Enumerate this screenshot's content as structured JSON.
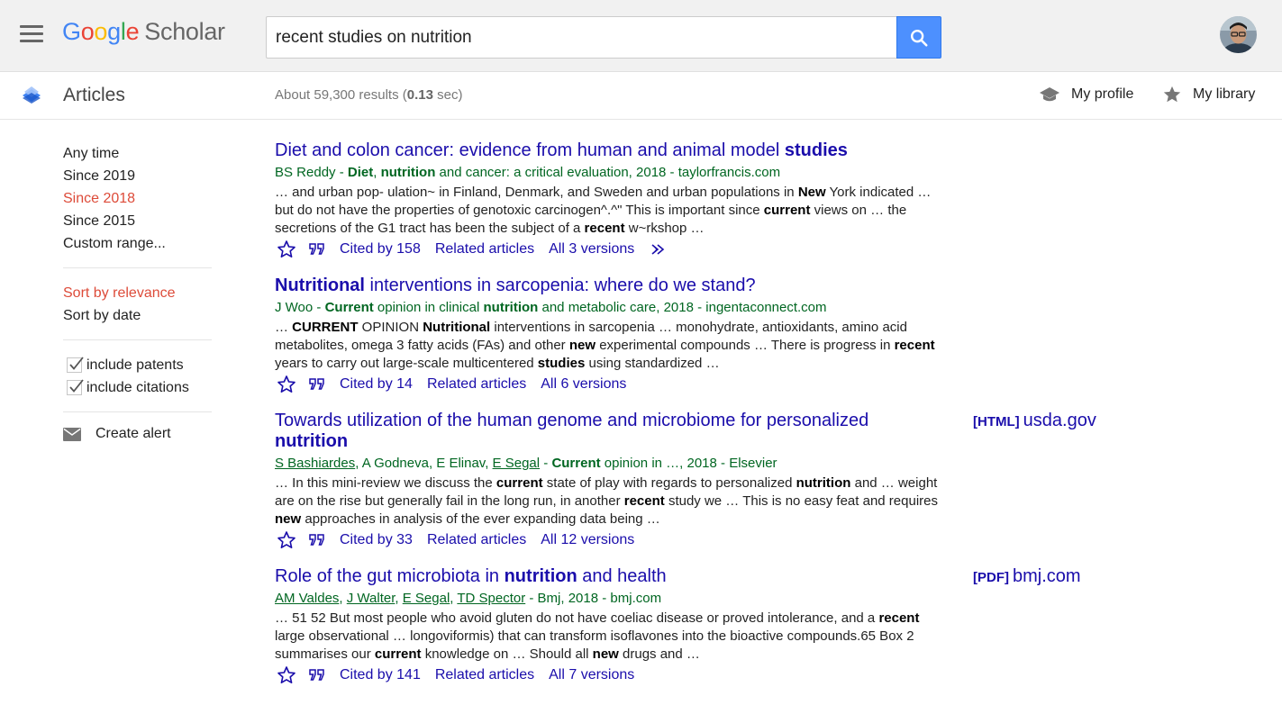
{
  "header": {
    "logo": {
      "g1": "G",
      "o1": "o",
      "o2": "o",
      "g2": "g",
      "l": "l",
      "e": "e",
      "product": "Scholar"
    },
    "search_value": "recent studies on nutrition",
    "colors": {
      "accent_blue": "#4285f4",
      "link": "#1a0dab",
      "meta_green": "#006621",
      "active_red": "#dd4b39"
    }
  },
  "subbar": {
    "section": "Articles",
    "stats_prefix": "About 59,300 results (",
    "stats_time": "0.13",
    "stats_suffix": " sec)",
    "my_profile": "My profile",
    "my_library": "My library"
  },
  "sidebar": {
    "time_filters": [
      "Any time",
      "Since 2019",
      "Since 2018",
      "Since 2015",
      "Custom range..."
    ],
    "active_time_index": 2,
    "sort": [
      "Sort by relevance",
      "Sort by date"
    ],
    "checkboxes": [
      "include patents",
      "include citations"
    ],
    "create_alert": "Create alert"
  },
  "results": [
    {
      "title": [
        [
          "Diet",
          false
        ],
        [
          " and colon cancer: evidence from human and animal model ",
          false
        ],
        [
          "studies",
          true
        ]
      ],
      "meta": [
        [
          "BS Reddy - ",
          false,
          false
        ],
        [
          "Diet",
          true,
          false
        ],
        [
          ", ",
          false,
          false
        ],
        [
          "nutrition",
          true,
          false
        ],
        [
          " and cancer: a critical evaluation, 2018 - taylorfrancis.com",
          false,
          false
        ]
      ],
      "snippet": [
        [
          "… and urban pop- ulation~ in Finland, Denmark, and Sweden and urban populations in ",
          false
        ],
        [
          "New",
          true
        ],
        [
          " York indicated … but do not have the properties of genotoxic carcinogen^.^\" This is important since ",
          false
        ],
        [
          "current",
          true
        ],
        [
          " views on … the secretions of the G1 tract has been the subject of a ",
          false
        ],
        [
          "recent",
          true
        ],
        [
          " w~rkshop …",
          false
        ]
      ],
      "cited": "Cited by 158",
      "related": "Related articles",
      "versions": "All 3 versions",
      "has_more": true
    },
    {
      "title": [
        [
          "Nutritional",
          true
        ],
        [
          " interventions in sarcopenia: where do we stand?",
          false
        ]
      ],
      "meta": [
        [
          "J Woo - ",
          false,
          false
        ],
        [
          "Current",
          true,
          false
        ],
        [
          " opinion in clinical ",
          false,
          false
        ],
        [
          "nutrition",
          true,
          false
        ],
        [
          " and metabolic care, 2018 - ingentaconnect.com",
          false,
          false
        ]
      ],
      "snippet": [
        [
          "… ",
          false
        ],
        [
          "CURRENT",
          true
        ],
        [
          " OPINION ",
          false
        ],
        [
          "Nutritional",
          true
        ],
        [
          " interventions in sarcopenia … monohydrate, antioxidants, amino acid metabolites, omega 3 fatty acids (FAs) and other ",
          false
        ],
        [
          "new",
          true
        ],
        [
          " experimental compounds … There is progress in ",
          false
        ],
        [
          "recent",
          true
        ],
        [
          " years to carry out large-scale multicentered ",
          false
        ],
        [
          "studies",
          true
        ],
        [
          " using standardized …",
          false
        ]
      ],
      "cited": "Cited by 14",
      "related": "Related articles",
      "versions": "All 6 versions",
      "has_more": false
    },
    {
      "title": [
        [
          "Towards utilization of the human genome and microbiome for personalized ",
          false
        ],
        [
          "nutrition",
          true
        ]
      ],
      "meta": [
        [
          "S Bashiardes",
          false,
          true
        ],
        [
          ", A Godneva, E Elinav, ",
          false,
          false
        ],
        [
          "E Segal",
          false,
          true
        ],
        [
          " - ",
          false,
          false
        ],
        [
          "Current",
          true,
          false
        ],
        [
          " opinion in …, 2018 - Elsevier",
          false,
          false
        ]
      ],
      "snippet": [
        [
          "… In this mini-review we discuss the ",
          false
        ],
        [
          "current",
          true
        ],
        [
          " state of play with regards to personalized ",
          false
        ],
        [
          "nutrition",
          true
        ],
        [
          " and … weight are on the rise but generally fail in the long run, in another ",
          false
        ],
        [
          "recent",
          true
        ],
        [
          " study we … This is no easy feat and requires ",
          false
        ],
        [
          "new",
          true
        ],
        [
          " approaches in analysis of the ever expanding data being …",
          false
        ]
      ],
      "cited": "Cited by 33",
      "related": "Related articles",
      "versions": "All 12 versions",
      "has_more": false,
      "side_format": "[HTML]",
      "side_source": "usda.gov"
    },
    {
      "title": [
        [
          "Role of the gut microbiota in ",
          false
        ],
        [
          "nutrition",
          true
        ],
        [
          " and health",
          false
        ]
      ],
      "meta": [
        [
          "AM Valdes",
          false,
          true
        ],
        [
          ", ",
          false,
          false
        ],
        [
          "J Walter",
          false,
          true
        ],
        [
          ", ",
          false,
          false
        ],
        [
          "E Segal",
          false,
          true
        ],
        [
          ", ",
          false,
          false
        ],
        [
          "TD Spector",
          false,
          true
        ],
        [
          " - Bmj, 2018 - bmj.com",
          false,
          false
        ]
      ],
      "snippet": [
        [
          "… 51 52 But most people who avoid gluten do not have coeliac disease or proved intolerance, and a ",
          false
        ],
        [
          "recent",
          true
        ],
        [
          " large observational … longoviformis) that can transform isoflavones into the bioactive compounds.65 Box 2 summarises our ",
          false
        ],
        [
          "current",
          true
        ],
        [
          " knowledge on … Should all ",
          false
        ],
        [
          "new",
          true
        ],
        [
          " drugs and …",
          false
        ]
      ],
      "cited": "Cited by 141",
      "related": "Related articles",
      "versions": "All 7 versions",
      "has_more": false,
      "side_format": "[PDF]",
      "side_source": "bmj.com"
    }
  ]
}
